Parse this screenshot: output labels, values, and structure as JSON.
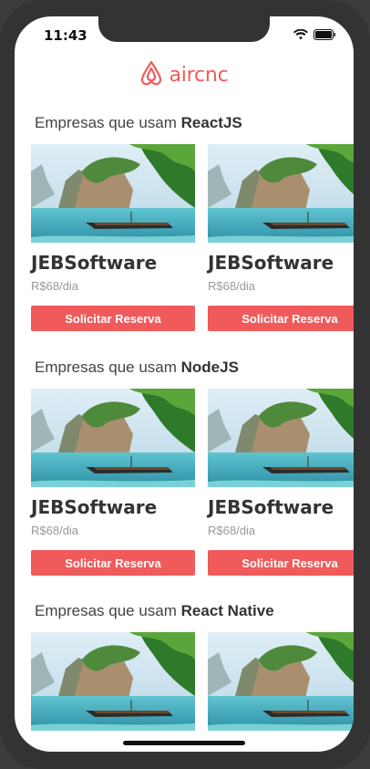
{
  "status": {
    "time": "11:43"
  },
  "app": {
    "brand": "aircnc",
    "brand_color": "#f05a5b"
  },
  "sections": [
    {
      "prefix": "Empresas que usam ",
      "tech": "ReactJS",
      "cards": [
        {
          "name": "JEBSoftware",
          "price": "R$68/dia",
          "button": "Solicitar Reserva"
        },
        {
          "name": "JEBSoftware",
          "price": "R$68/dia",
          "button": "Solicitar Reserva"
        }
      ]
    },
    {
      "prefix": "Empresas que usam ",
      "tech": "NodeJS",
      "cards": [
        {
          "name": "JEBSoftware",
          "price": "R$68/dia",
          "button": "Solicitar Reserva"
        },
        {
          "name": "JEBSoftware",
          "price": "R$68/dia",
          "button": "Solicitar Reserva"
        }
      ]
    },
    {
      "prefix": "Empresas que usam ",
      "tech": "React Native",
      "cards": [
        {
          "name": "",
          "price": "",
          "button": ""
        },
        {
          "name": "",
          "price": "",
          "button": ""
        }
      ]
    }
  ]
}
